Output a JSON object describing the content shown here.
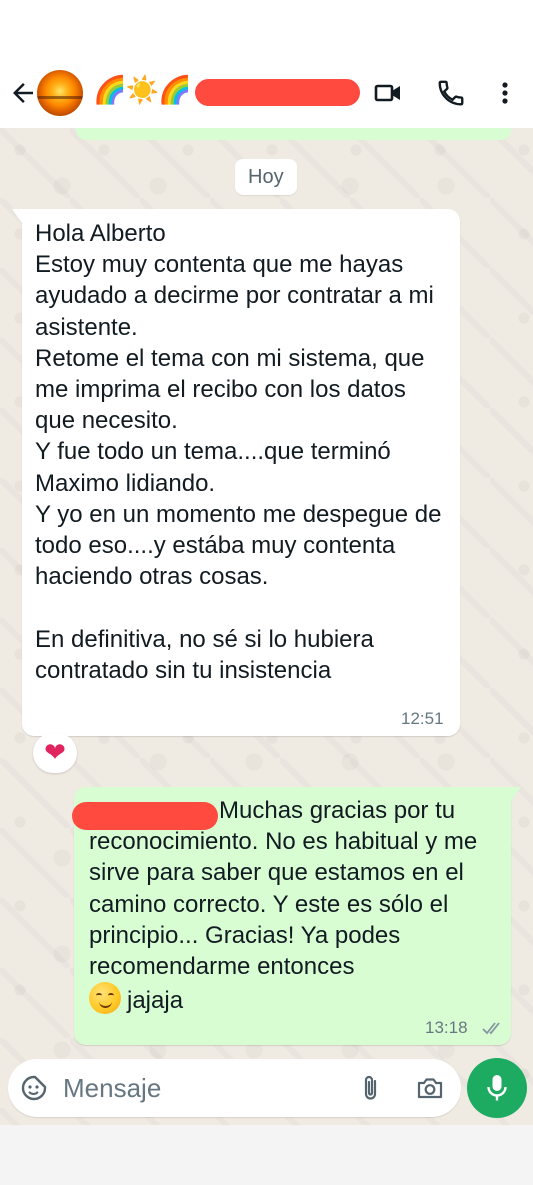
{
  "header": {
    "contact_emoji": "🌈☀️🌈",
    "icons": [
      "back-arrow-icon",
      "video-call-icon",
      "phone-call-icon",
      "more-options-icon"
    ]
  },
  "chat": {
    "day_label": "Hoy",
    "incoming": {
      "text": "Hola Alberto\nEstoy muy contenta que me hayas ayudado a decirme por contratar a mi asistente.\nRetome el tema con mi sistema, que me imprima el recibo con los datos que necesito.\nY fue todo un tema....que terminó Maximo lidiando.\nY yo en un momento me despegue de todo eso....y estába muy contenta haciendo otras cosas.\n\nEn definitiva, no sé si lo hubiera contratado sin tu insistencia",
      "time": "12:51",
      "reaction": "❤"
    },
    "outgoing": {
      "text": "Muchas gracias por tu reconocimiento. No es habitual y me sirve para saber que estamos en el camino correcto. Y este es sólo el principio... Gracias! Ya podes recomendarme entonces",
      "tail_text": "jajaja",
      "emoji": "smiling-face-icon",
      "time": "13:18",
      "status": "read"
    }
  },
  "composer": {
    "placeholder": "Mensaje"
  },
  "colors": {
    "chat_bg": "#efeae2",
    "outgoing_bubble": "#d9fdd3",
    "incoming_bubble": "#ffffff",
    "accent_green": "#1daa61",
    "redaction": "#fe4a3f",
    "read_ticks": "#8696a0"
  }
}
